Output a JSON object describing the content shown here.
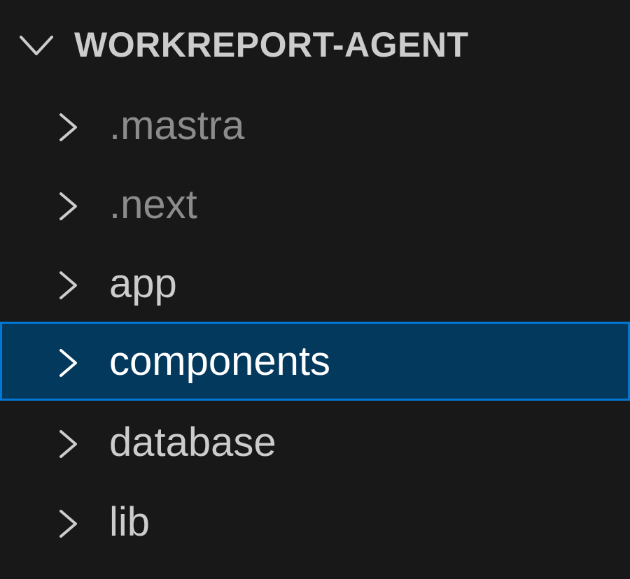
{
  "explorer": {
    "section_title": "WORKREPORT-AGENT",
    "section_expanded": true,
    "items": [
      {
        "label": ".mastra",
        "type": "folder",
        "expanded": false,
        "gitignored": true,
        "selected": false
      },
      {
        "label": ".next",
        "type": "folder",
        "expanded": false,
        "gitignored": true,
        "selected": false
      },
      {
        "label": "app",
        "type": "folder",
        "expanded": false,
        "gitignored": false,
        "selected": false
      },
      {
        "label": "components",
        "type": "folder",
        "expanded": false,
        "gitignored": false,
        "selected": true
      },
      {
        "label": "database",
        "type": "folder",
        "expanded": false,
        "gitignored": false,
        "selected": false
      },
      {
        "label": "lib",
        "type": "folder",
        "expanded": false,
        "gitignored": false,
        "selected": false
      }
    ]
  },
  "colors": {
    "background": "#181818",
    "text": "#cccccc",
    "ignored_text": "#8c8c8c",
    "selection_background": "#04395e",
    "focus_border": "#0078d4"
  },
  "icons": {
    "section_toggle": "chevron-down-icon",
    "folder_toggle": "chevron-right-icon"
  }
}
